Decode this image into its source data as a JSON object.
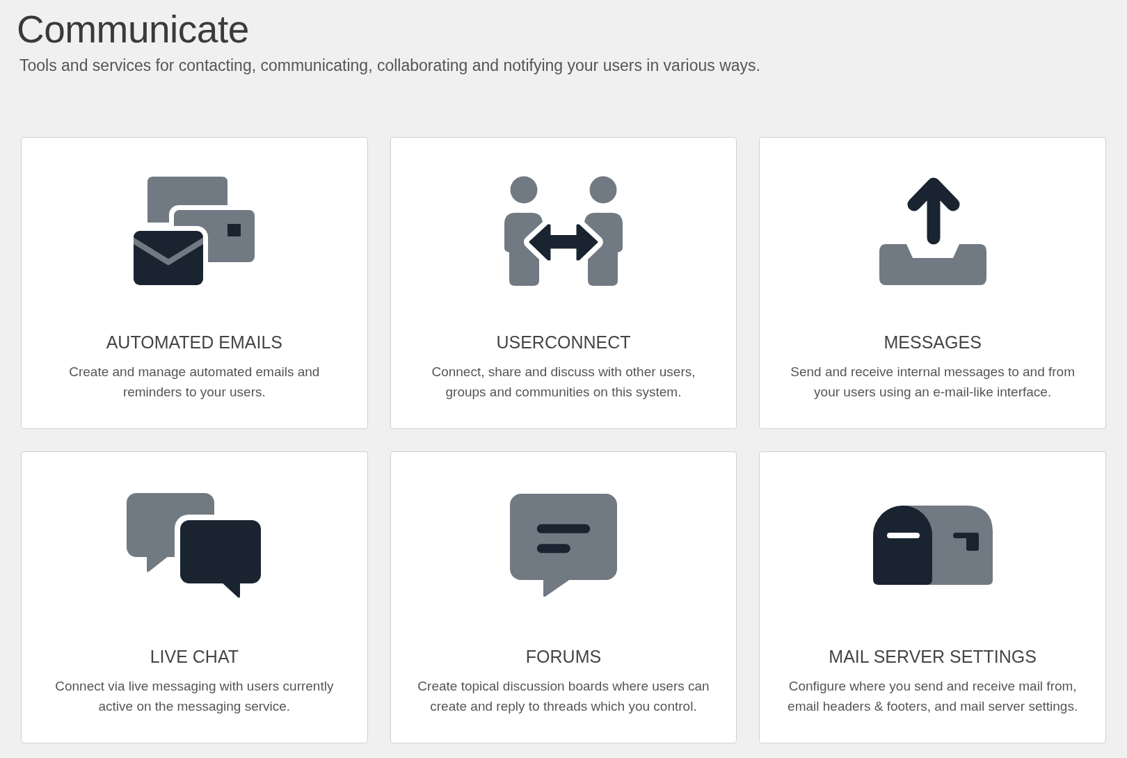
{
  "page": {
    "title": "Communicate",
    "subtitle": "Tools and services for contacting, communicating, collaborating and notifying your users in various ways."
  },
  "cards": [
    {
      "kind": "emails",
      "title": "AUTOMATED EMAILS",
      "description": "Create and manage automated emails and reminders to your users."
    },
    {
      "kind": "userconnect",
      "title": "USERCONNECT",
      "description": "Connect, share and discuss with other users, groups and communities on this system."
    },
    {
      "kind": "messages",
      "title": "MESSAGES",
      "description": "Send and receive internal messages to and from your users using an e-mail-like interface."
    },
    {
      "kind": "chat",
      "title": "LIVE CHAT",
      "description": "Connect via live messaging with users currently active on the messaging service."
    },
    {
      "kind": "forums",
      "title": "FORUMS",
      "description": "Create topical discussion boards where users can create and reply to threads which you control."
    },
    {
      "kind": "mailserver",
      "title": "MAIL SERVER SETTINGS",
      "description": "Configure where you send and receive mail from, email headers & footers, and mail server settings."
    }
  ]
}
